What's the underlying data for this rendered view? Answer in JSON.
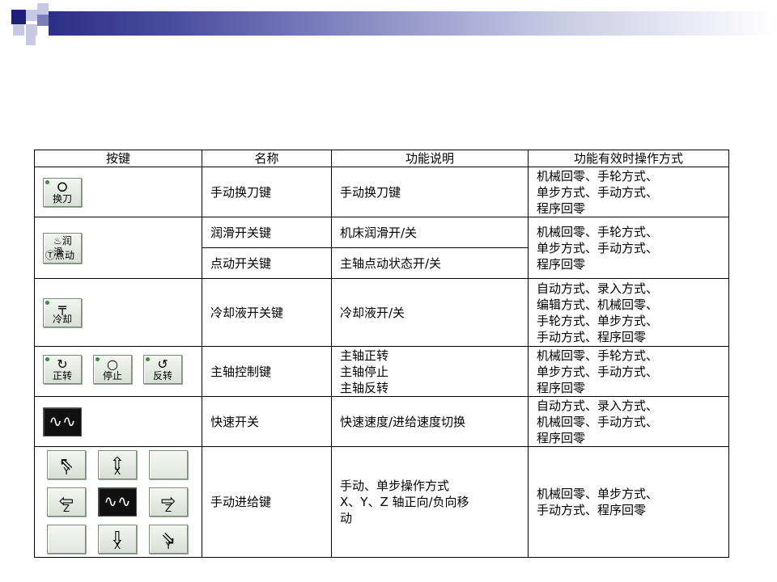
{
  "table": {
    "headers": [
      "按键",
      "名称",
      "功能说明",
      "功能有效时操作方式"
    ],
    "rows": [
      {
        "name": "手动换刀键",
        "func": "手动换刀键",
        "modes": "机械回零、手轮方式、\n单步方式、手动方式、\n程序回零"
      },
      {
        "name": "润滑开关键",
        "func": "机床润滑开/关",
        "modes": "机械回零、手轮方式、\n单步方式、手动方式、\n程序回零"
      },
      {
        "name": "点动开关键",
        "func": "主轴点动状态开/关"
      },
      {
        "name": "冷却液开关键",
        "func": "冷却液开/关",
        "modes": "自动方式、录入方式、\n编辑方式、机械回零、\n手轮方式、单步方式、\n手动方式、程序回零"
      },
      {
        "name": "主轴控制键",
        "func": "主轴正转\n主轴停止\n主轴反转",
        "modes": "机械回零、手轮方式、\n单步方式、手动方式、\n程序回零"
      },
      {
        "name": "快速开关",
        "func": "快速速度/进给速度切换",
        "modes": "自动方式、录入方式、\n机械回零、手动方式、\n程序回零"
      },
      {
        "name": "手动进给键",
        "func": "手动、单步操作方式\nX、Y、Z 轴正向/负向移\n动",
        "modes": "机械回零、单步方式、\n手动方式、程序回零"
      }
    ]
  },
  "keys": {
    "tool_change": "换刀",
    "lube": "润滑",
    "jog": "点动",
    "coolant": "冷却",
    "spindle_fwd": "正转",
    "spindle_stop": "停止",
    "spindle_rev": "反转",
    "feed": {
      "x_pos": "X",
      "x_neg": "X",
      "z_pos": "Z",
      "z_neg": "Z",
      "y_pos": "Y",
      "y_neg": "Y"
    }
  }
}
